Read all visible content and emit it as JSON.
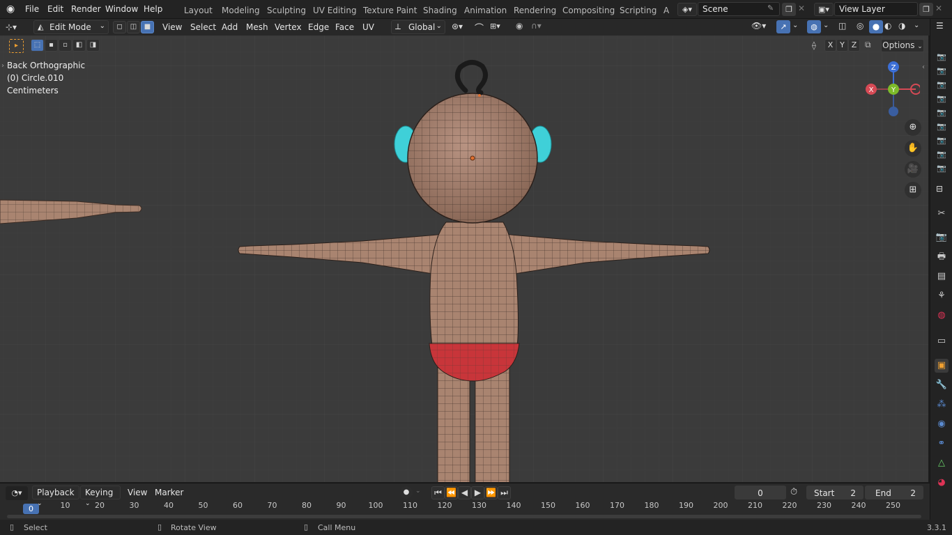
{
  "topbar": {
    "menus": [
      "File",
      "Edit",
      "Render",
      "Window",
      "Help"
    ],
    "workspaces": [
      "Layout",
      "Modeling",
      "Sculpting",
      "UV Editing",
      "Texture Paint",
      "Shading",
      "Animation",
      "Rendering",
      "Compositing",
      "Scripting",
      "A"
    ],
    "scene_name": "Scene",
    "view_layer": "View Layer"
  },
  "header": {
    "mode": "Edit Mode",
    "menus": [
      "View",
      "Select",
      "Add",
      "Mesh",
      "Vertex",
      "Edge",
      "Face",
      "UV"
    ],
    "transform_orientation": "Global",
    "axes": [
      "X",
      "Y",
      "Z"
    ],
    "options_label": "Options"
  },
  "viewport": {
    "view_name": "Back Orthographic",
    "object_info": "(0) Circle.010",
    "units": "Centimeters",
    "gizmo": {
      "z": "Z",
      "y": "Y",
      "x": "X"
    },
    "colors": {
      "background": "#3b3b3b",
      "skin": "#a98470",
      "shorts": "#c8353a",
      "ears": "#3fd0d8",
      "hair": "#1a1a1a"
    }
  },
  "timeline": {
    "menus": [
      "Playback",
      "Keying",
      "View",
      "Marker"
    ],
    "current_frame": "0",
    "start_label": "Start",
    "start_value": "2",
    "end_label": "End",
    "end_value": "2",
    "ticks": [
      "0",
      "10",
      "20",
      "30",
      "40",
      "50",
      "60",
      "70",
      "80",
      "90",
      "100",
      "110",
      "120",
      "130",
      "140",
      "150",
      "160",
      "170",
      "180",
      "190",
      "200",
      "210",
      "220",
      "230",
      "240",
      "250"
    ]
  },
  "statusbar": {
    "select": "Select",
    "rotate": "Rotate View",
    "call_menu": "Call Menu",
    "version": "3.3.1"
  }
}
